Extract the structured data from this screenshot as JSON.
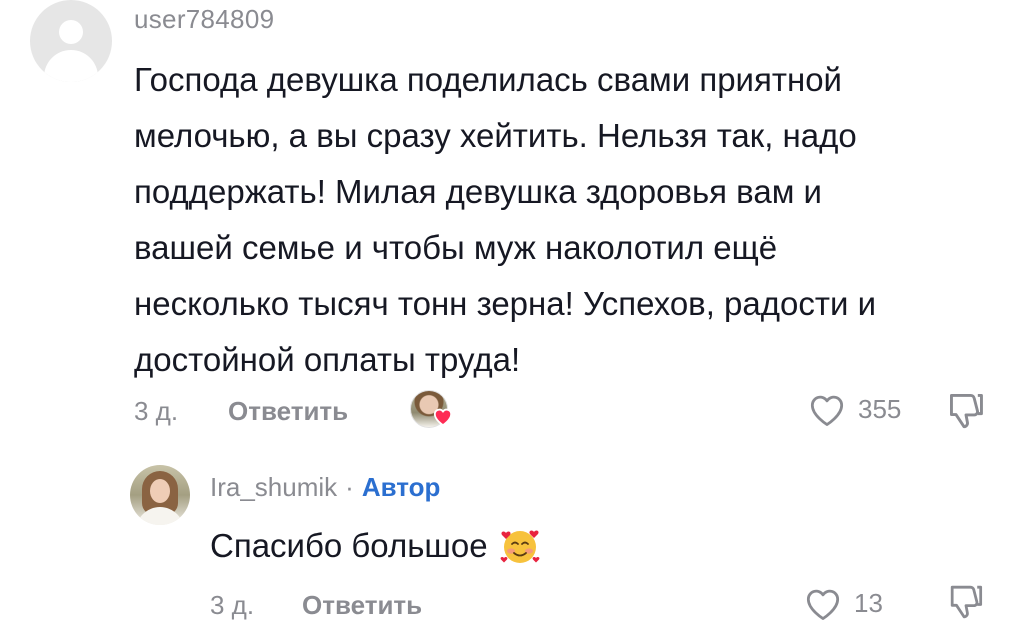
{
  "comment": {
    "username": "user784809",
    "text_lines": [
      "Господа девушка поделилась свами приятной",
      "мелочью, а вы сразу хейтить. Нельзя так, надо",
      "поддержать! Милая девушка здоровья вам и",
      "вашей семье и чтобы муж наколотил ещё",
      "несколько тысяч тонн зерна! Успехов, радости и",
      "достойной оплаты труда!"
    ],
    "time": "3 д.",
    "reply_label": "Ответить",
    "like_count": "355",
    "icons": {
      "avatar": "default-avatar-icon",
      "creator_liked": "creator-liked-heart-icon",
      "like": "heart-outline-icon",
      "dislike": "thumbs-down-icon"
    }
  },
  "reply": {
    "username": "Ira_shumik",
    "separator": "·",
    "author_badge": "Автор",
    "text": "Спасибо большое",
    "emoji": "smiling-face-with-hearts",
    "time": "3 д.",
    "reply_label": "Ответить",
    "like_count": "13"
  },
  "colors": {
    "text": "#161823",
    "muted": "#8a8b91",
    "author_badge": "#2b6fd0",
    "heart": "#fe2c55"
  }
}
